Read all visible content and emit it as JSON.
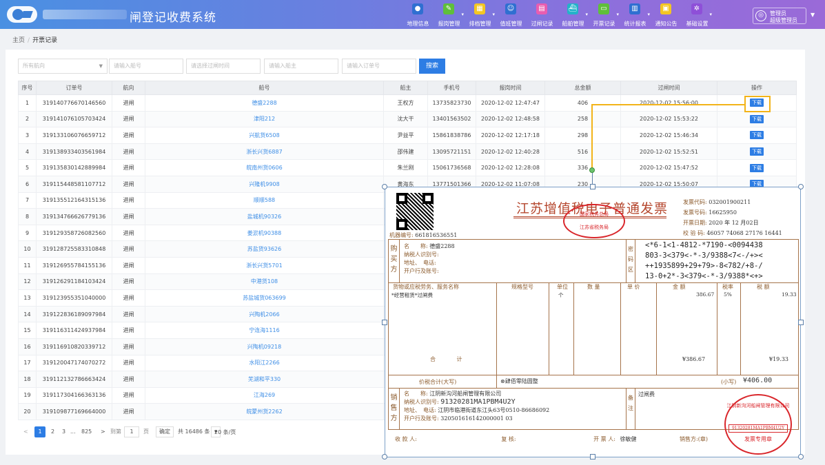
{
  "header": {
    "system_title": "闸登记收费系统",
    "nav": [
      {
        "label": "地理信息",
        "icon": "map-pin-icon",
        "color": "#2f6fd1",
        "caret": false
      },
      {
        "label": "报岗管理",
        "icon": "pencil-icon",
        "color": "#5fbf3b",
        "caret": true
      },
      {
        "label": "排档管理",
        "icon": "grid-icon",
        "color": "#f3c623",
        "caret": true
      },
      {
        "label": "值班管理",
        "icon": "people-icon",
        "color": "#2f6fd1",
        "caret": false
      },
      {
        "label": "过闸记录",
        "icon": "document-icon",
        "color": "#e85db0",
        "caret": false
      },
      {
        "label": "船舶管理",
        "icon": "ship-icon",
        "color": "#23b2c9",
        "caret": true
      },
      {
        "label": "开票记录",
        "icon": "receipt-icon",
        "color": "#5fbf3b",
        "caret": true
      },
      {
        "label": "统计报表",
        "icon": "chart-icon",
        "color": "#2f6fd1",
        "caret": true
      },
      {
        "label": "通知公告",
        "icon": "notice-icon",
        "color": "#f3c623",
        "caret": false
      },
      {
        "label": "基础设置",
        "icon": "gear-icon",
        "color": "#8e4fd8",
        "caret": true
      }
    ],
    "user": {
      "line1": "管理员",
      "line2": "超级管理员"
    }
  },
  "breadcrumb": {
    "home": "主页",
    "separator": "/",
    "current": "开票记录"
  },
  "filters": {
    "route_placeholder": "所有航向",
    "ship_no_placeholder": "请输入船号",
    "time_placeholder": "请选择过闸时间",
    "owner_placeholder": "请输入船主",
    "order_placeholder": "请输入订单号",
    "search_label": "搜索"
  },
  "table": {
    "columns": [
      "序号",
      "订单号",
      "航向",
      "船号",
      "船主",
      "手机号",
      "报岗时间",
      "总金额",
      "过闸时间",
      "操作"
    ],
    "download_label": "下载",
    "rows": [
      [
        "1",
        "319140776670146560",
        "进闸",
        "德盛2288",
        "王权方",
        "13735823730",
        "2020-12-02 12:47:47",
        "406",
        "2020-12-02 15:56:00"
      ],
      [
        "2",
        "319141076105703424",
        "进闸",
        "津阳212",
        "沈大干",
        "13401563502",
        "2020-12-02 12:48:58",
        "258",
        "2020-12-02 15:53:22"
      ],
      [
        "3",
        "319133106076659712",
        "进闸",
        "兴航货6508",
        "尹益平",
        "15861838786",
        "2020-12-02 12:17:18",
        "298",
        "2020-12-02 15:46:34"
      ],
      [
        "4",
        "319138933403561984",
        "进闸",
        "浙长兴货6887",
        "邵伟建",
        "13095721151",
        "2020-12-02 12:40:28",
        "516",
        "2020-12-02 15:52:51"
      ],
      [
        "5",
        "319135830142889984",
        "进闸",
        "皖南州货0606",
        "朱兰刚",
        "15061736568",
        "2020-12-02 12:28:08",
        "336",
        "2020-12-02 15:47:52"
      ],
      [
        "6",
        "319115448581107712",
        "进闸",
        "兴隆机9908",
        "黄海东",
        "13771501366",
        "2020-12-02 11:07:08",
        "230",
        "2020-12-02 15:50:07"
      ],
      [
        "7",
        "319135512164315136",
        "进闸",
        "顺顺588",
        "",
        "",
        "",
        "",
        ""
      ],
      [
        "8",
        "319134766626779136",
        "进闸",
        "盐城机90326",
        "",
        "",
        "",
        "",
        ""
      ],
      [
        "9",
        "319129358726082560",
        "进闸",
        "姜淤机90388",
        "",
        "",
        "",
        "",
        ""
      ],
      [
        "10",
        "319128725583310848",
        "进闸",
        "苏盐货93626",
        "",
        "",
        "",
        "",
        ""
      ],
      [
        "11",
        "319126955784155136",
        "进闸",
        "浙长兴货5701",
        "",
        "",
        "",
        "",
        ""
      ],
      [
        "12",
        "319126291184103424",
        "进闸",
        "中港货108",
        "",
        "",
        "",
        "",
        ""
      ],
      [
        "13",
        "319123955351040000",
        "进闸",
        "苏盐城货063699",
        "",
        "",
        "",
        "",
        ""
      ],
      [
        "14",
        "319122836189097984",
        "进闸",
        "兴陶机2066",
        "",
        "",
        "",
        "",
        ""
      ],
      [
        "15",
        "319116311424937984",
        "进闸",
        "宁连海1116",
        "",
        "",
        "",
        "",
        ""
      ],
      [
        "16",
        "319116910820339712",
        "进闸",
        "兴陶机09218",
        "",
        "",
        "",
        "",
        ""
      ],
      [
        "17",
        "319120047174070272",
        "进闸",
        "水阳江2266",
        "",
        "",
        "",
        "",
        ""
      ],
      [
        "18",
        "319112132786663424",
        "进闸",
        "芜湖和平330",
        "",
        "",
        "",
        "",
        ""
      ],
      [
        "19",
        "319117304166363136",
        "进闸",
        "江海269",
        "",
        "",
        "",
        "",
        ""
      ],
      [
        "20",
        "319109877169664000",
        "进闸",
        "皖蒙州货2262",
        "",
        "",
        "",
        "",
        ""
      ]
    ]
  },
  "pager": {
    "prev": "<",
    "pages": [
      "1",
      "2",
      "3",
      "...",
      "825"
    ],
    "next": ">",
    "goto_label": "到第",
    "goto_value": "1",
    "page_unit": "页",
    "confirm": "确定",
    "total": "共 16486 条",
    "page_size": "20 条/页"
  },
  "invoice": {
    "title": "江苏增值税电子普通发票",
    "stamp_text": [
      "国家税务总局",
      "江苏省税务局"
    ],
    "code_label": "发票代码:",
    "code": "032001900211",
    "number_label": "发票号码:",
    "number": "16625950",
    "date_label": "开票日期:",
    "date": "2020 年 12 月02日",
    "check_label": "校 验 码:",
    "check": "46057 74068 27176 16441",
    "machine_label": "机器编号:",
    "machine": "661816536551",
    "buyer_side": "购买方",
    "buyer_name_label": "名　　称:",
    "buyer_name": "德盛2288",
    "buyer_tax_label": "纳税人识别号:",
    "buyer_addr_label": "地址、　电话:",
    "buyer_bank_label": "开户行及账号:",
    "cipher_side": "密码区",
    "cipher": [
      "<*6-1<1-4812-*7190-<0094438",
      "803-3<379<-*-3/9388<7<-/+><",
      "++1935899+29+79>-8<782/+8-/",
      "13-0+2*-3<379<-*-3/9388*<+>"
    ],
    "item_headers": [
      "货物或应税劳务、服务名称",
      "规格型号",
      "单位",
      "数 量",
      "单 价",
      "金 额",
      "税率",
      "税 额"
    ],
    "item": {
      "name": "*经营租赁*过闸费",
      "unit": "个",
      "amount": "386.67",
      "rate": "5%",
      "tax": "19.33"
    },
    "total_label": "合 计",
    "total_amount": "¥386.67",
    "total_tax": "¥19.33",
    "sum_label": "价税合计(大写)",
    "sum_upper": "肆佰零陆圆整",
    "sum_small_label": "(小写)",
    "sum_small": "¥406.00",
    "seller_side": "销售方",
    "seller_name_label": "名　　称:",
    "seller_name": "江阴新沟河船闸管理有限公司",
    "seller_tax_label": "纳税人识别号:",
    "seller_tax": "91320281MA1PBM4U2Y",
    "seller_addr_label": "地址、　电话:",
    "seller_addr": "江阴市临港街道东江头63号0510-86686092",
    "seller_bank_label": "开户行及账号:",
    "seller_bank": "320501616142000001 03",
    "remark_side": "备注",
    "remark": "过闸费",
    "receiver_label": "收 款 人:",
    "reviewer_label": "复 核:",
    "issuer_label": "开 票 人:",
    "issuer": "徐敏健",
    "seller_sign_label": "销售方:(章)",
    "seal": {
      "name": "江阴新沟河船闸管理有限公司",
      "tax": "91320281MA1PBM4U2Y",
      "purpose": "发票专用章"
    }
  }
}
